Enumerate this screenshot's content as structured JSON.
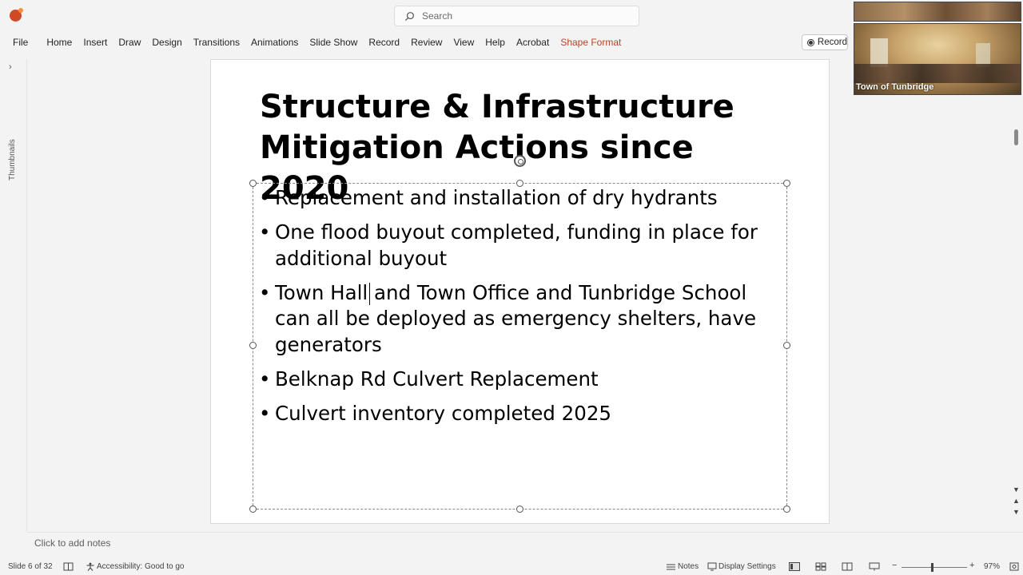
{
  "search": {
    "placeholder": "Search"
  },
  "ribbon": {
    "tabs": [
      "File",
      "Home",
      "Insert",
      "Draw",
      "Design",
      "Transitions",
      "Animations",
      "Slide Show",
      "Record",
      "Review",
      "View",
      "Help",
      "Acrobat",
      "Shape Format"
    ],
    "record_button": "Record"
  },
  "video": {
    "participant": "Town of Tunbridge"
  },
  "thumbnails": {
    "label": "Thumbnails"
  },
  "slide": {
    "title_line1": "Structure & Infrastructure",
    "title_line2": "Mitigation Actions since 2020",
    "bullets": [
      "Replacement and installation of dry hydrants",
      "One flood buyout completed, funding in place for additional buyout",
      "Town Hall and Town Office and Tunbridge School can all be deployed as emergency shelters, have generators",
      "Belknap Rd Culvert Replacement",
      "Culvert inventory completed 2025"
    ]
  },
  "notes": {
    "placeholder": "Click to add notes"
  },
  "status": {
    "slide_counter": "Slide 6 of 32",
    "accessibility": "Accessibility: Good to go",
    "notes_label": "Notes",
    "display_settings": "Display Settings",
    "zoom": "97%",
    "zoom_minus": "−",
    "zoom_plus": "+"
  }
}
